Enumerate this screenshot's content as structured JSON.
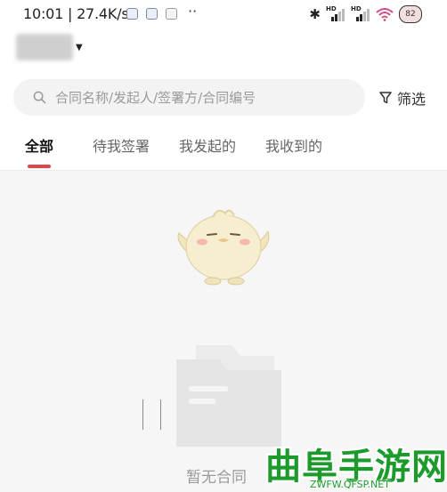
{
  "status_bar": {
    "time": "10:01 | 27.4K/s",
    "overflow": "··",
    "battery": "82",
    "signal_1_label": "HD",
    "signal_2_label": "HD"
  },
  "header": {
    "account_name_redacted": true
  },
  "search": {
    "placeholder": "合同名称/发起人/签署方/合同编号"
  },
  "filter": {
    "label": "筛选"
  },
  "tabs": [
    {
      "label": "全部",
      "active": true
    },
    {
      "label": "待我签署",
      "active": false
    },
    {
      "label": "我发起的",
      "active": false
    },
    {
      "label": "我收到的",
      "active": false
    }
  ],
  "empty_state": {
    "text": "暂无合同"
  },
  "watermark": {
    "main": "曲阜手游网",
    "sub": "ZWFW.QFSP.NET"
  },
  "colors": {
    "accent": "#e0444e",
    "watermark": "#1c9b2c",
    "content_bg": "#f6f6f6"
  }
}
